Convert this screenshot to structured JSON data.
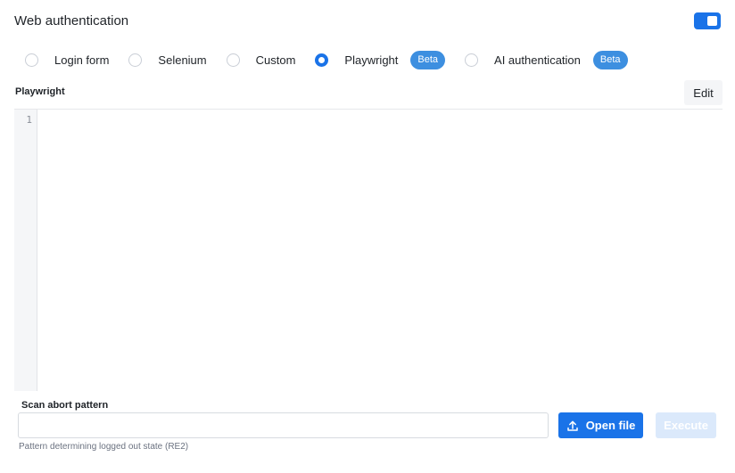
{
  "header": {
    "title": "Web authentication",
    "toggle_on": true
  },
  "auth_methods": [
    {
      "label": "Login form",
      "selected": false,
      "badge": ""
    },
    {
      "label": "Selenium",
      "selected": false,
      "badge": ""
    },
    {
      "label": "Custom",
      "selected": false,
      "badge": ""
    },
    {
      "label": "Playwright",
      "selected": true,
      "badge": "Beta"
    },
    {
      "label": "AI authentication",
      "selected": false,
      "badge": "Beta"
    }
  ],
  "editor": {
    "section_label": "Playwright",
    "edit_label": "Edit",
    "line_numbers": [
      "1"
    ]
  },
  "abort": {
    "label": "Scan abort pattern",
    "value": "",
    "open_file_label": "Open file",
    "execute_label": "Execute",
    "helper": "Pattern determining logged out state (RE2)"
  },
  "colors": {
    "accent": "#1a73e8",
    "badge": "#3d8fe0",
    "execute_disabled": "#dbe9fb"
  }
}
